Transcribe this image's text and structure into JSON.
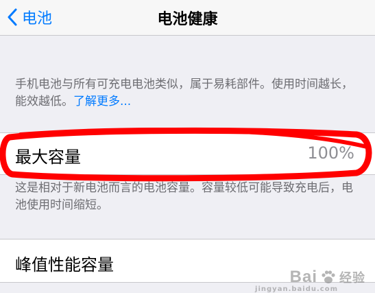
{
  "navbar": {
    "back_label": "电池",
    "title": "电池健康"
  },
  "battery_note": {
    "text": "手机电池与所有可充电电池类似，属于易耗部件。使用时间越长，能效越低。",
    "link_label": "了解更多..."
  },
  "max_capacity": {
    "label": "最大容量",
    "value": "100%",
    "annotation_color": "#ff0000"
  },
  "capacity_note": "这是相对于新电池而言的电池容量。容量较低可能导致充电后，电池使用时间缩短。",
  "peak_performance": {
    "label": "峰值性能容量"
  },
  "watermark": {
    "brand_left": "Bai",
    "brand_icon": "paw-icon",
    "brand_right": "经验",
    "sub": "jingyan.baidu.com"
  },
  "colors": {
    "accent": "#007aff",
    "background": "#efeff4",
    "secondary_text": "#6d6d72",
    "value_text": "#8e8e93"
  }
}
